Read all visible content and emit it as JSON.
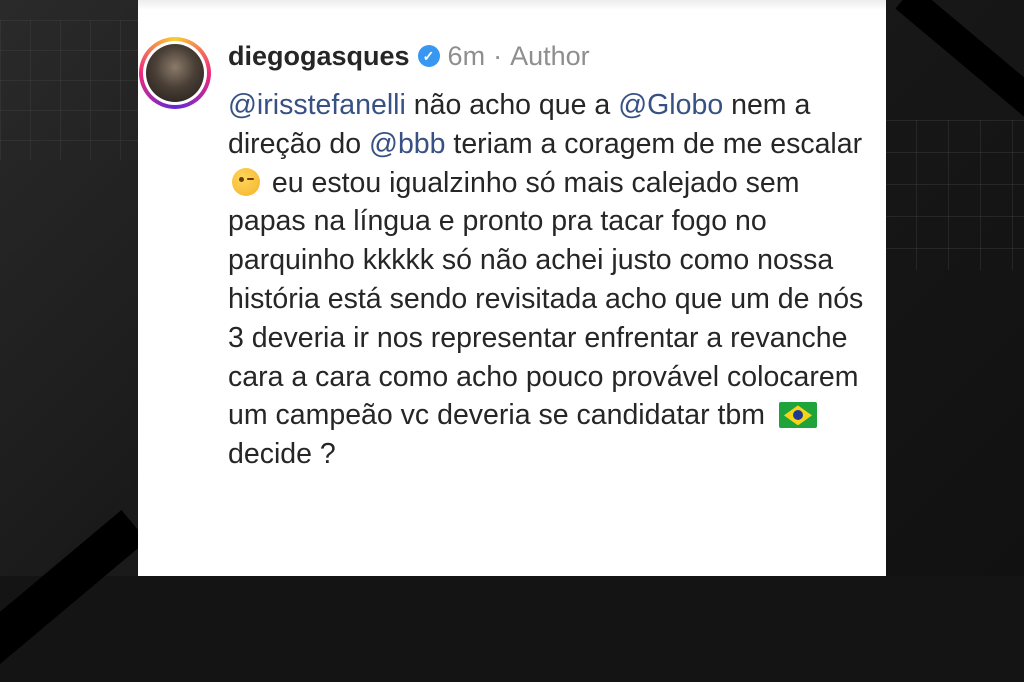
{
  "comment": {
    "username": "diegogasques",
    "time": "6m",
    "separator": "·",
    "role": "Author",
    "mention1": "@irisstefanelli",
    "text1": " não acho que a ",
    "mention2": "@Globo",
    "text2": " nem a direção do ",
    "mention3": "@bbb",
    "text3": " teriam a coragem de me escalar ",
    "text4": " eu estou igualzinho só mais calejado sem papas na língua e pronto pra tacar fogo no parquinho kkkkk só não achei justo como nossa história está sendo revisitada acho que um de nós 3 deveria ir nos representar enfrentar a revanche cara a cara como acho pouco provável colocarem um campeão vc deveria se candidatar tbm ",
    "text5": " decide ?",
    "emoji_wink": "winking-face-emoji",
    "emoji_flag": "brazil-flag-emoji"
  },
  "icons": {
    "verified": "verified-badge-icon"
  }
}
